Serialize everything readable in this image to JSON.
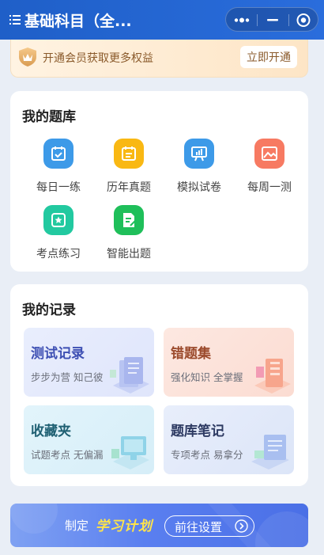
{
  "header": {
    "title": "基础科目（全...",
    "capsule": {
      "more_icon": "more-dots-icon",
      "minimize_icon": "minimize-icon",
      "close_icon": "record-close-icon"
    }
  },
  "member_banner": {
    "text": "开通会员获取更多权益",
    "button_label": "立即开通",
    "icon": "crown-badge-icon"
  },
  "question_bank": {
    "title": "我的题库",
    "items": [
      {
        "label": "每日一练",
        "icon": "calendar-check-icon",
        "color": "#3d9ae8"
      },
      {
        "label": "历年真题",
        "icon": "calendar-list-icon",
        "color": "#f9b813"
      },
      {
        "label": "模拟试卷",
        "icon": "presentation-chart-icon",
        "color": "#3d9ae8"
      },
      {
        "label": "每周一测",
        "icon": "image-chart-icon",
        "color": "#f77a62"
      },
      {
        "label": "考点练习",
        "icon": "star-badge-icon",
        "color": "#22c9a0"
      },
      {
        "label": "智能出题",
        "icon": "document-edit-icon",
        "color": "#1fbf5a"
      }
    ]
  },
  "records": {
    "title": "我的记录",
    "items": [
      {
        "title": "测试记录",
        "subtitle": "步步为营 知己彼",
        "title_color": "#3d4fb3",
        "bg": "#e6ebfc",
        "icon": "test-record-illustration"
      },
      {
        "title": "错题集",
        "subtitle": "强化知识 全掌握",
        "title_color": "#9b4a2c",
        "bg": "#fde4dc",
        "icon": "wrong-questions-illustration"
      },
      {
        "title": "收藏夹",
        "subtitle": "试题考点 无偏漏",
        "title_color": "#1f6073",
        "bg": "#dff2fa",
        "icon": "favorites-illustration"
      },
      {
        "title": "题库笔记",
        "subtitle": "专项考点 易拿分",
        "title_color": "#2d3a62",
        "bg": "#e6edfa",
        "icon": "notes-illustration"
      }
    ]
  },
  "plan_banner": {
    "prefix": "制定",
    "highlight": "学习计划",
    "button_label": "前往设置",
    "button_icon": "chevron-right-circle-icon"
  }
}
